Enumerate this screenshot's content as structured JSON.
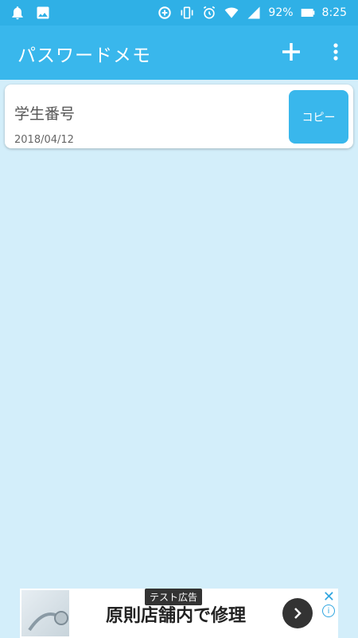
{
  "status_bar": {
    "battery": "92%",
    "time": "8:25",
    "icons_left": [
      "bell-icon",
      "image-icon"
    ],
    "icons_right": [
      "data-saver-icon",
      "vibrate-icon",
      "alarm-icon",
      "wifi-icon",
      "signal-icon",
      "battery-icon"
    ]
  },
  "app_bar": {
    "title": "パスワードメモ",
    "add_icon": "plus-icon",
    "menu_icon": "more-vert-icon"
  },
  "entries": [
    {
      "title": "学生番号",
      "date": "2018/04/12",
      "copy_label": "コピー"
    }
  ],
  "ad": {
    "label": "テスト広告",
    "text": "原則店舗内で修理",
    "arrow_icon": "chevron-right-icon",
    "close_icon": "close-icon",
    "info_icon": "info-icon"
  },
  "colors": {
    "primary": "#39b7ec",
    "primary_dark": "#2fb0e6",
    "background": "#d3eefa"
  }
}
